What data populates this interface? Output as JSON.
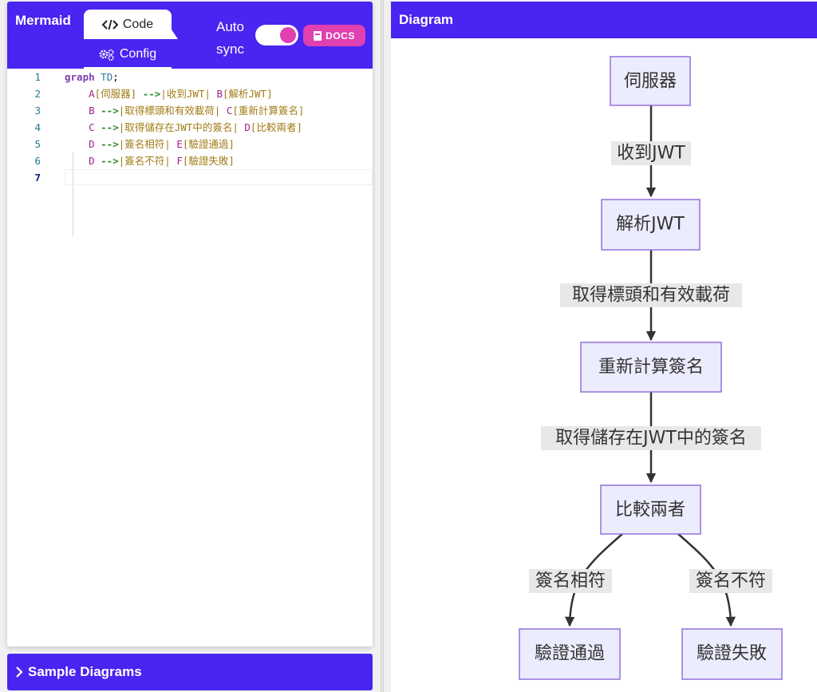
{
  "app": {
    "brand": "Mermaid"
  },
  "editor_tabs": {
    "code": "Code",
    "config": "Config"
  },
  "auto_sync": {
    "label": "Auto sync",
    "enabled": true
  },
  "docs_button": {
    "label": "DOCS"
  },
  "code_lines": [
    {
      "num": "1",
      "parts": [
        {
          "t": "graph",
          "c": "kw"
        },
        {
          "t": " TD",
          "c": "td"
        },
        {
          "t": ";",
          "c": "plain"
        }
      ]
    },
    {
      "num": "2",
      "parts": [
        {
          "t": "    A",
          "c": "nid"
        },
        {
          "t": "[伺服器] ",
          "c": "lbl"
        },
        {
          "t": "-->",
          "c": "arr"
        },
        {
          "t": "|收到JWT| ",
          "c": "lbl"
        },
        {
          "t": "B",
          "c": "nid"
        },
        {
          "t": "[解析JWT]",
          "c": "lbl"
        }
      ]
    },
    {
      "num": "3",
      "parts": [
        {
          "t": "    B ",
          "c": "nid"
        },
        {
          "t": "-->",
          "c": "arr"
        },
        {
          "t": "|取得標頭和有效載荷| ",
          "c": "lbl"
        },
        {
          "t": "C",
          "c": "nid"
        },
        {
          "t": "[重新計算簽名]",
          "c": "lbl"
        }
      ]
    },
    {
      "num": "4",
      "parts": [
        {
          "t": "    C ",
          "c": "nid"
        },
        {
          "t": "-->",
          "c": "arr"
        },
        {
          "t": "|取得儲存在JWT中的簽名| ",
          "c": "lbl"
        },
        {
          "t": "D",
          "c": "nid"
        },
        {
          "t": "[比較兩者]",
          "c": "lbl"
        }
      ]
    },
    {
      "num": "5",
      "parts": [
        {
          "t": "    D ",
          "c": "nid"
        },
        {
          "t": "-->",
          "c": "arr"
        },
        {
          "t": "|簽名相符| ",
          "c": "lbl"
        },
        {
          "t": "E",
          "c": "nid"
        },
        {
          "t": "[驗證通過]",
          "c": "lbl"
        }
      ]
    },
    {
      "num": "6",
      "parts": [
        {
          "t": "    D ",
          "c": "nid"
        },
        {
          "t": "-->",
          "c": "arr"
        },
        {
          "t": "|簽名不符| ",
          "c": "lbl"
        },
        {
          "t": "F",
          "c": "nid"
        },
        {
          "t": "[驗證失敗]",
          "c": "lbl"
        }
      ]
    },
    {
      "num": "7",
      "parts": []
    }
  ],
  "sample_diagrams": {
    "label": "Sample Diagrams"
  },
  "diagram_panel": {
    "title": "Diagram"
  },
  "diagram": {
    "nodes": {
      "A": "伺服器",
      "B": "解析JWT",
      "C": "重新計算簽名",
      "D": "比較兩者",
      "E": "驗證通過",
      "F": "驗證失敗"
    },
    "edges": {
      "ab": "收到JWT",
      "bc": "取得標頭和有效載荷",
      "cd": "取得儲存在JWT中的簽名",
      "de": "簽名相符",
      "df": "簽名不符"
    }
  },
  "colors": {
    "accent": "#4a24f0",
    "pink": "#e040b0",
    "node_fill": "#ececff",
    "node_stroke": "#9370db"
  }
}
